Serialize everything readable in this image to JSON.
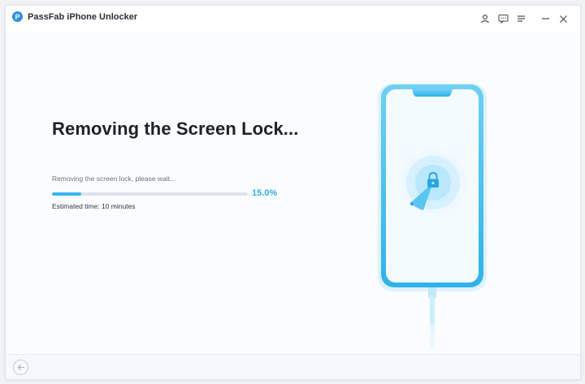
{
  "app": {
    "title": "PassFab iPhone Unlocker",
    "logo_letter": "P"
  },
  "titlebar": {
    "icons": [
      "user-icon",
      "feedback-icon",
      "menu-icon",
      "minimize-icon",
      "close-icon"
    ]
  },
  "main": {
    "heading": "Removing the Screen Lock...",
    "status_text": "Removing the screen lock, please wait...",
    "progress_value": 15.0,
    "progress_label": "15.0%",
    "estimate_text": "Estimated time: 10 minutes"
  },
  "illustration": {
    "icon": "lock-icon"
  },
  "footer": {
    "back_icon": "back-arrow-icon"
  },
  "colors": {
    "accent": "#35b7ef",
    "accent_text": "#31aee8",
    "phone_frame": "#4cc0ee",
    "title_text": "#1d2129"
  }
}
